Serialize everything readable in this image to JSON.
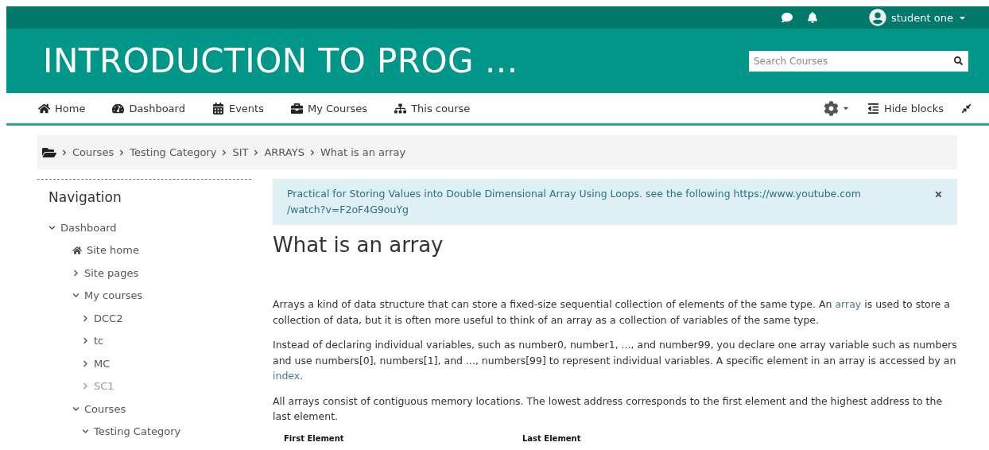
{
  "user_menu": {
    "name": "student one"
  },
  "header": {
    "title": "INTRODUCTION TO PROG ...",
    "search": {
      "placeholder": "Search Courses"
    }
  },
  "nav": [
    {
      "label": "Home",
      "kind": "home"
    },
    {
      "label": "Dashboard",
      "kind": "gauge"
    },
    {
      "label": "Events",
      "kind": "calendar"
    },
    {
      "label": "My Courses",
      "kind": "briefcase"
    },
    {
      "label": "This course",
      "kind": "sitemap"
    }
  ],
  "hide_blocks": {
    "label": "Hide blocks"
  },
  "breadcrumb": [
    "Courses",
    "Testing Category",
    "SIT",
    "ARRAYS",
    "What is an array"
  ],
  "navigation": {
    "title": "Navigation",
    "items": [
      {
        "label": "Dashboard",
        "kind": "branch",
        "expanded": true,
        "dimmed": false,
        "children": [
          {
            "label": "Site home",
            "kind": "home",
            "dimmed": false
          },
          {
            "label": "Site pages",
            "kind": "branch",
            "expanded": false,
            "dimmed": false
          },
          {
            "label": "My courses",
            "kind": "branch",
            "expanded": true,
            "dimmed": false,
            "children": [
              {
                "label": "DCC2",
                "kind": "branch",
                "expanded": false,
                "dimmed": false
              },
              {
                "label": "tc",
                "kind": "branch",
                "expanded": false,
                "dimmed": false
              },
              {
                "label": "MC",
                "kind": "branch",
                "expanded": false,
                "dimmed": false
              },
              {
                "label": "SC1",
                "kind": "branch",
                "expanded": false,
                "dimmed": true
              }
            ]
          },
          {
            "label": "Courses",
            "kind": "branch",
            "expanded": true,
            "dimmed": false,
            "children": [
              {
                "label": "Testing Category",
                "kind": "branch",
                "expanded": true,
                "dimmed": false
              }
            ]
          }
        ]
      }
    ]
  },
  "alert": {
    "lines": [
      "Practical for Storing Values into Double Dimensional Array Using Loops. see the following https://www.youtube.com",
      "/watch?v=F2oF4G9ouYg"
    ]
  },
  "page_title": "What is an array",
  "paragraphs": [
    [
      {
        "kind": "text",
        "text": "Arrays a kind of data structure that can store a fixed-size sequential collection of elements of the same type. An "
      },
      {
        "kind": "link",
        "text": "array"
      },
      {
        "kind": "text",
        "text": " is used to store a collection of data, but it is often more useful to think of an array as a collection of variables of the same type."
      }
    ],
    [
      {
        "kind": "text",
        "text": "Instead of declaring individual variables, such as number0, number1, ..., and number99, you declare one array variable such as numbers and use numbers[0], numbers[1], and ..., numbers[99] to represent individual variables. A specific element in an array is accessed by an "
      },
      {
        "kind": "link",
        "text": "index"
      },
      {
        "kind": "text",
        "text": "."
      }
    ],
    [
      {
        "kind": "text",
        "text": "All arrays consist of contiguous memory locations. The lowest address corresponds to the first element and the highest address to the last element."
      }
    ]
  ],
  "diagram_labels": [
    "First Element",
    "Last Element"
  ]
}
